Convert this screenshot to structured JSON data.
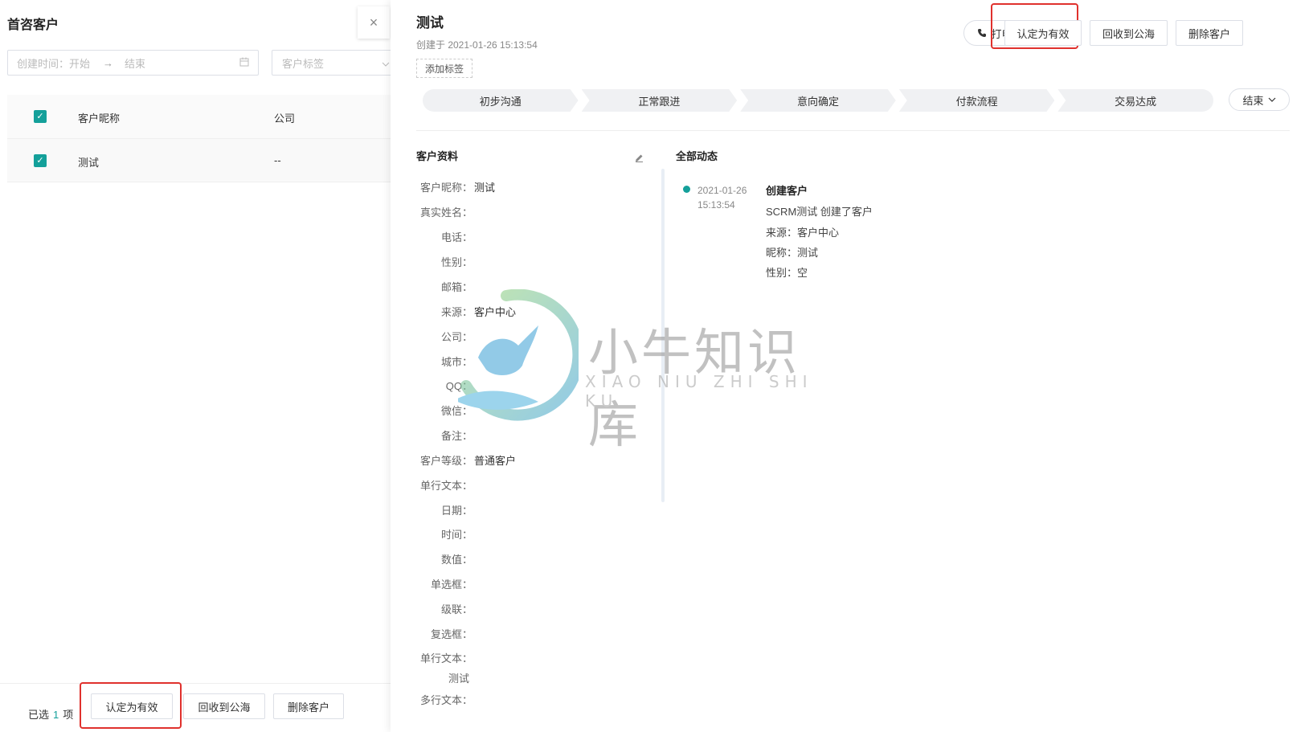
{
  "left_panel": {
    "title": "首咨客户",
    "close_glyph": "×",
    "date_start_placeholder": "创建时间：开始",
    "date_arrow": "→",
    "date_end_placeholder": "结束",
    "tag_placeholder": "客户标签",
    "table": {
      "headers": [
        "客户昵称",
        "公司"
      ],
      "rows": [
        {
          "name": "测试",
          "company": "--"
        }
      ]
    },
    "selection": {
      "prefix": "已选",
      "count": "1",
      "suffix": "项"
    },
    "actions": {
      "mark_valid": "认定为有效",
      "recycle": "回收到公海",
      "delete": "删除客户"
    }
  },
  "detail": {
    "name": "测试",
    "created": "创建于 2021-01-26 15:13:54",
    "add_tag": "添加标签",
    "actions": {
      "call": "打电话",
      "mark_valid": "认定为有效",
      "recycle": "回收到公海",
      "delete": "删除客户"
    },
    "stages": [
      "初步沟通",
      "正常跟进",
      "意向确定",
      "付款流程",
      "交易达成"
    ],
    "end_label": "结束",
    "profile_title": "客户资料",
    "fields": [
      {
        "label": "客户昵称：",
        "value": "测试"
      },
      {
        "label": "真实姓名：",
        "value": ""
      },
      {
        "label": "电话：",
        "value": ""
      },
      {
        "label": "性别：",
        "value": ""
      },
      {
        "label": "邮箱：",
        "value": ""
      },
      {
        "label": "来源：",
        "value": "客户中心"
      },
      {
        "label": "公司：",
        "value": ""
      },
      {
        "label": "城市：",
        "value": ""
      },
      {
        "label": "QQ：",
        "value": ""
      },
      {
        "label": "微信：",
        "value": ""
      },
      {
        "label": "备注：",
        "value": ""
      },
      {
        "label": "客户等级：",
        "value": "普通客户"
      },
      {
        "label": "单行文本：",
        "value": ""
      },
      {
        "label": "日期：",
        "value": ""
      },
      {
        "label": "时间：",
        "value": ""
      },
      {
        "label": "数值：",
        "value": ""
      },
      {
        "label": "单选框：",
        "value": ""
      },
      {
        "label": "级联：",
        "value": ""
      },
      {
        "label": "复选框：",
        "value": ""
      },
      {
        "label": "单行文本：",
        "value": "测试"
      },
      {
        "label": "多行文本：",
        "value": ""
      }
    ],
    "activity_title": "全部动态",
    "timeline": [
      {
        "date": "2021-01-26",
        "time": "15:13:54",
        "title": "创建客户",
        "lines": [
          "SCRM测试 创建了客户",
          "来源：客户中心",
          "昵称：测试",
          "性别：空"
        ]
      }
    ]
  },
  "watermark": {
    "text": "小牛知识库",
    "subtext": "XIAO NIU ZHI SHI KU"
  },
  "colors": {
    "accent": "#14a09a",
    "highlight": "#e0312d"
  }
}
